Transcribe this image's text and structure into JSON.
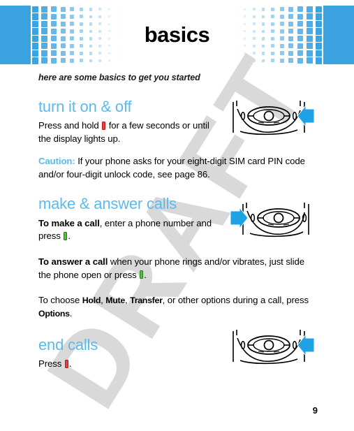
{
  "banner": {
    "title": "basics",
    "accent_color": "#3ba4e0"
  },
  "watermark": {
    "text": "DRAFT",
    "color": "#d9d9d9"
  },
  "page": {
    "subtitle": "here are some basics to get you started",
    "number": "9",
    "heading_color": "#5cb9ec"
  },
  "sections": [
    {
      "heading": "turn it on & off",
      "paragraphs": [
        {
          "pre": "Press and hold ",
          "glyph": "power-key-glyph",
          "glyph_color": "#ef3c3c",
          "post": " for a few seconds or until the display lights up."
        },
        {
          "lead": "Caution:",
          "lead_style": "caution",
          "text": " If your phone asks for your eight-digit SIM card PIN code and/or four-digit unlock code, see page 86."
        }
      ],
      "diagram": {
        "name": "phone-navigation-keypad",
        "arrow_direction": "left",
        "arrow_color": "#1ea2e6",
        "highlight_key": "right-soft-key"
      }
    },
    {
      "heading": "make & answer calls",
      "paragraphs": [
        {
          "lead": "To make a call",
          "lead_style": "bold",
          "pre": ", enter a phone number and press ",
          "glyph": "send-key-glyph",
          "glyph_color": "#4fc23a",
          "post": "."
        },
        {
          "lead": "To answer a call",
          "lead_style": "bold",
          "pre": " when your phone rings and/or vibrates, just slide the phone open or press ",
          "glyph": "send-key-glyph",
          "glyph_color": "#4fc23a",
          "post": "."
        },
        {
          "pre": "To choose ",
          "options": [
            "Hold",
            "Mute",
            "Transfer"
          ],
          "mid": ", or other options during a call, press ",
          "options_tail": "Options",
          "post": "."
        }
      ],
      "diagram": {
        "name": "phone-navigation-keypad",
        "arrow_direction": "right",
        "arrow_color": "#1ea2e6",
        "highlight_key": "left-soft-key"
      }
    },
    {
      "heading": "end calls",
      "paragraphs": [
        {
          "pre": "Press ",
          "glyph": "end-key-glyph",
          "glyph_color": "#ef3c3c",
          "post": "."
        }
      ],
      "diagram": {
        "name": "phone-navigation-keypad",
        "arrow_direction": "left",
        "arrow_color": "#1ea2e6",
        "highlight_key": "right-soft-key"
      }
    }
  ]
}
